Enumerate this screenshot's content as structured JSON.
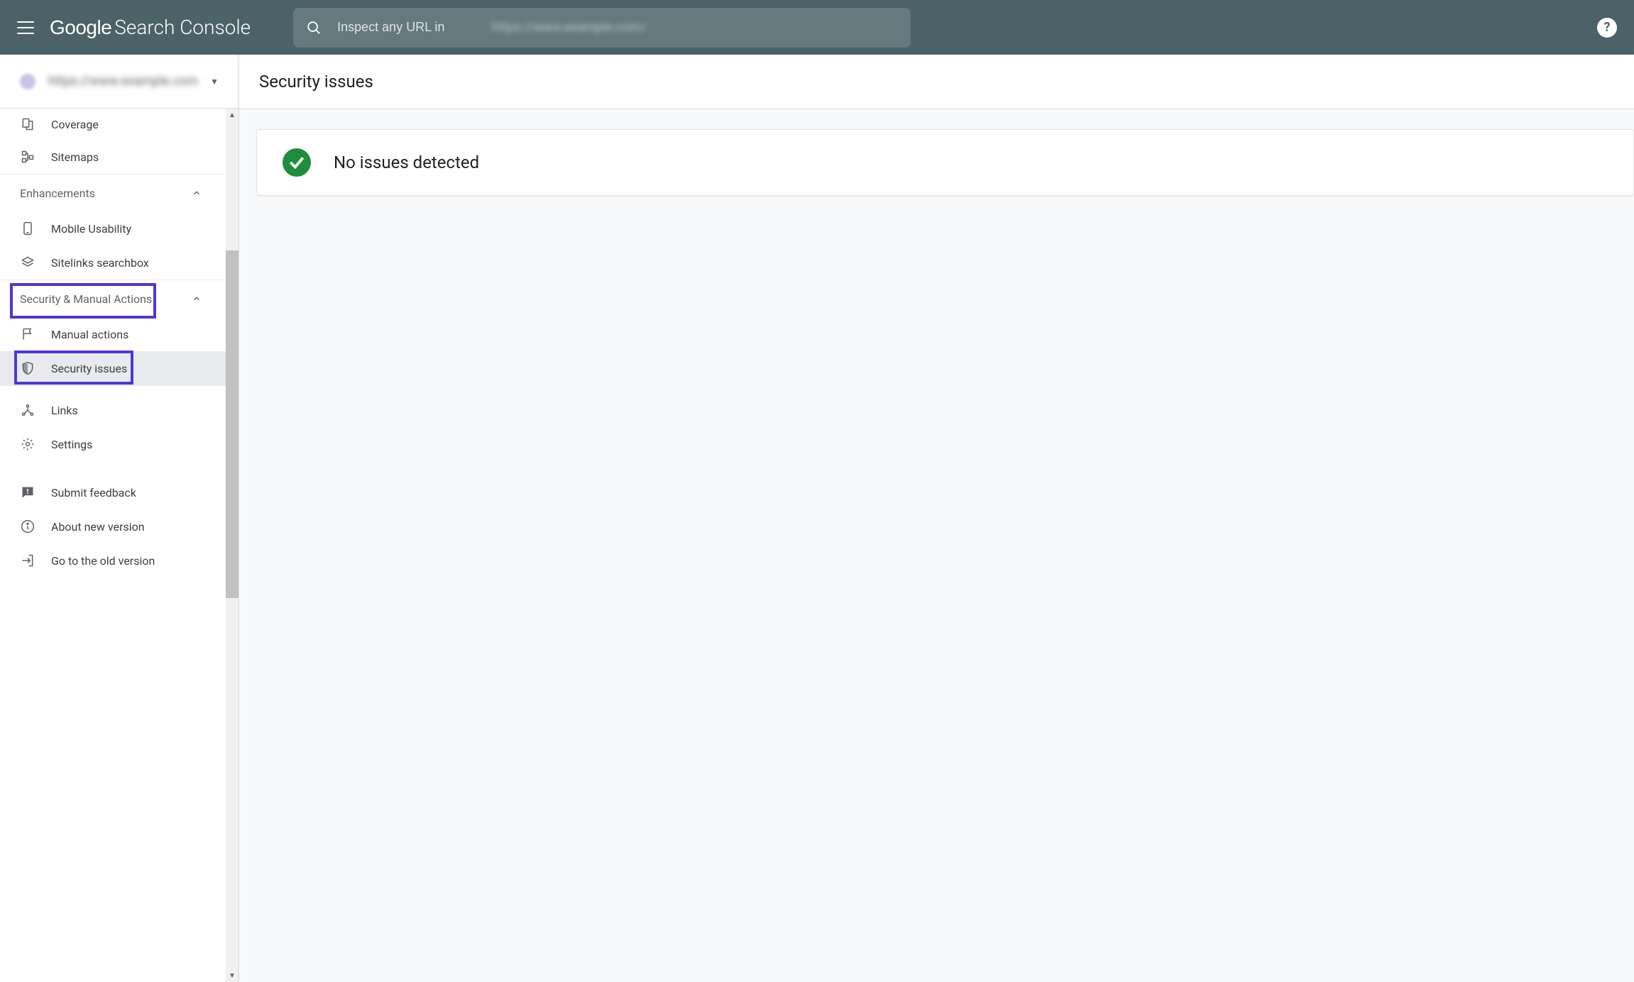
{
  "header": {
    "logo_primary": "Google",
    "logo_secondary": "Search Console",
    "search_placeholder": "Inspect any URL in ",
    "search_blurred": "https://www.example.com/",
    "help_label": "?"
  },
  "sidebar": {
    "property_name": "https://www.example.com",
    "items": [
      {
        "id": "coverage",
        "label": "Coverage",
        "icon": "file"
      },
      {
        "id": "sitemaps",
        "label": "Sitemaps",
        "icon": "tree"
      }
    ],
    "sections": [
      {
        "title": "Enhancements",
        "expanded": true,
        "items": [
          {
            "id": "mobile-usability",
            "label": "Mobile Usability",
            "icon": "mobile"
          },
          {
            "id": "sitelinks-searchbox",
            "label": "Sitelinks searchbox",
            "icon": "layers"
          }
        ]
      },
      {
        "title": "Security & Manual Actions",
        "expanded": true,
        "highlighted": true,
        "items": [
          {
            "id": "manual-actions",
            "label": "Manual actions",
            "icon": "flag"
          },
          {
            "id": "security-issues",
            "label": "Security issues",
            "icon": "shield",
            "selected": true,
            "highlighted": true
          }
        ]
      }
    ],
    "footer_items": [
      {
        "id": "links",
        "label": "Links",
        "icon": "links"
      },
      {
        "id": "settings",
        "label": "Settings",
        "icon": "gear"
      },
      {
        "id": "submit-feedback",
        "label": "Submit feedback",
        "icon": "feedback"
      },
      {
        "id": "about-new-version",
        "label": "About new version",
        "icon": "info"
      },
      {
        "id": "go-to-old-version",
        "label": "Go to the old version",
        "icon": "exit"
      }
    ]
  },
  "main": {
    "title": "Security issues",
    "status_message": "No issues detected"
  },
  "colors": {
    "header_bg": "#4a6268",
    "success": "#1e8e3e",
    "annotation": "#5135da"
  }
}
